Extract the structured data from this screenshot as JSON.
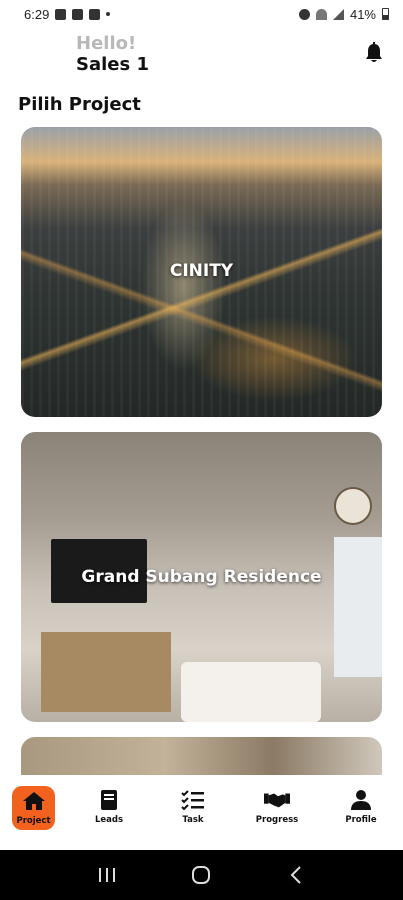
{
  "status_bar": {
    "time": "6:29",
    "battery": "41%"
  },
  "header": {
    "greeting": "Hello!",
    "username": "Sales 1"
  },
  "section_title": "Pilih Project",
  "projects": [
    {
      "name": "CINITY"
    },
    {
      "name": "Grand Subang Residence"
    },
    {
      "name": ""
    }
  ],
  "nav": {
    "items": [
      {
        "label": "Project",
        "icon": "home-icon",
        "active": true
      },
      {
        "label": "Leads",
        "icon": "book-icon",
        "active": false
      },
      {
        "label": "Task",
        "icon": "checklist-icon",
        "active": false
      },
      {
        "label": "Progress",
        "icon": "handshake-icon",
        "active": false
      },
      {
        "label": "Profile",
        "icon": "person-icon",
        "active": false
      }
    ]
  },
  "colors": {
    "accent": "#f2611e",
    "text": "#111111",
    "muted": "#b8b8b8"
  }
}
